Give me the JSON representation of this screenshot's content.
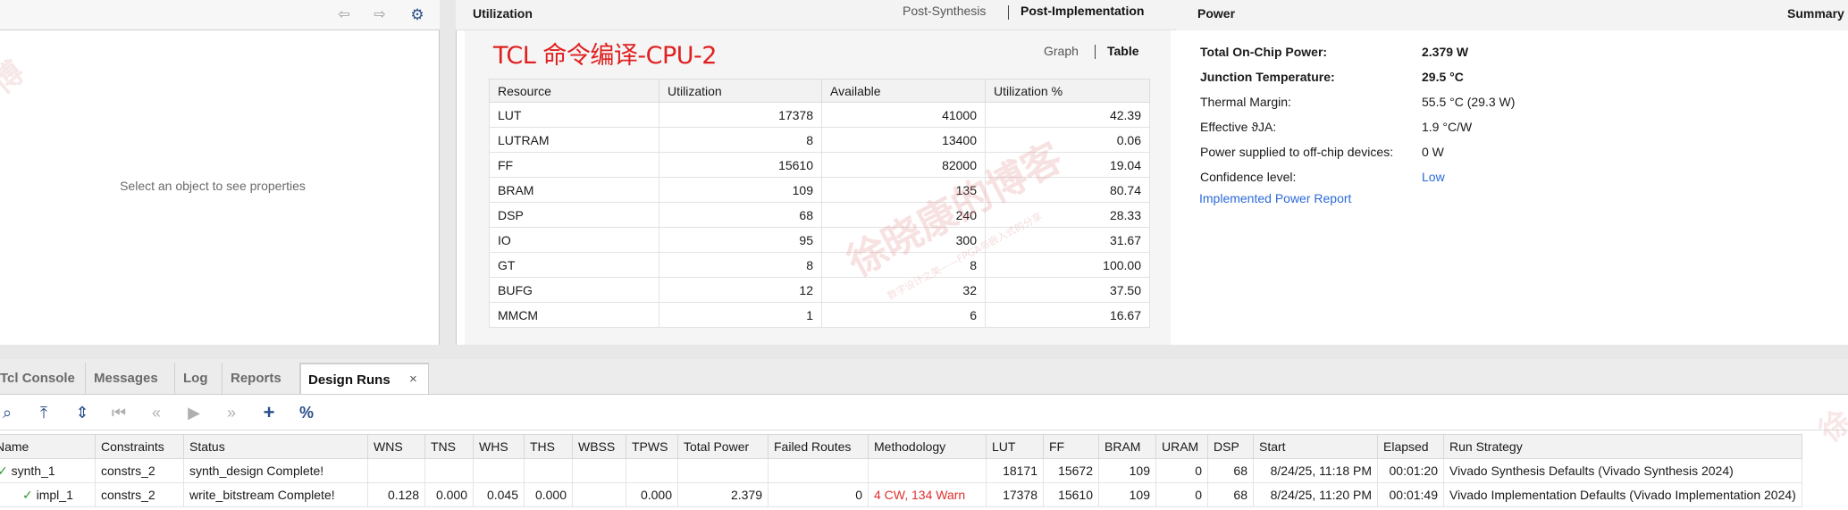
{
  "properties": {
    "empty_text": "Select an object to see properties",
    "icons": [
      "back-arrow-icon",
      "forward-arrow-icon",
      "gear-icon"
    ]
  },
  "utilization": {
    "title": "Utilization",
    "tabs": [
      "Post-Synthesis",
      "Post-Implementation"
    ],
    "active_tab": "Post-Implementation",
    "subtitle": "TCL 命令编译-CPU-2",
    "view_tabs": [
      "Graph",
      "Table"
    ],
    "active_view": "Table",
    "columns": [
      "Resource",
      "Utilization",
      "Available",
      "Utilization %"
    ],
    "rows": [
      {
        "resource": "LUT",
        "utilization": "17378",
        "available": "41000",
        "percent": "42.39"
      },
      {
        "resource": "LUTRAM",
        "utilization": "8",
        "available": "13400",
        "percent": "0.06"
      },
      {
        "resource": "FF",
        "utilization": "15610",
        "available": "82000",
        "percent": "19.04"
      },
      {
        "resource": "BRAM",
        "utilization": "109",
        "available": "135",
        "percent": "80.74"
      },
      {
        "resource": "DSP",
        "utilization": "68",
        "available": "240",
        "percent": "28.33"
      },
      {
        "resource": "IO",
        "utilization": "95",
        "available": "300",
        "percent": "31.67"
      },
      {
        "resource": "GT",
        "utilization": "8",
        "available": "8",
        "percent": "100.00"
      },
      {
        "resource": "BUFG",
        "utilization": "12",
        "available": "32",
        "percent": "37.50"
      },
      {
        "resource": "MMCM",
        "utilization": "1",
        "available": "6",
        "percent": "16.67"
      }
    ]
  },
  "power": {
    "title": "Power",
    "summary_label": "Summary",
    "rows": [
      {
        "key": "Total On-Chip Power:",
        "value": "2.379 W"
      },
      {
        "key": "Junction Temperature:",
        "value": "29.5 °C"
      },
      {
        "key": "Thermal Margin:",
        "value": "55.5 °C (29.3 W)"
      },
      {
        "key": "Effective ϑJA:",
        "value": "1.9 °C/W"
      },
      {
        "key": "Power supplied to off-chip devices:",
        "value": "0 W"
      },
      {
        "key": "Confidence level:",
        "value": "Low"
      }
    ],
    "report_link": "Implemented Power Report"
  },
  "bottom": {
    "tabs": [
      "Tcl Console",
      "Messages",
      "Log",
      "Reports",
      "Design Runs"
    ],
    "active_tab": "Design Runs",
    "close_glyph": "×",
    "toolbar_icons": [
      "search-icon",
      "collapse-all-icon",
      "expand-all-icon",
      "first-icon",
      "previous-icon",
      "run-icon",
      "next-icon",
      "add-icon",
      "percent-icon"
    ],
    "runs": {
      "columns": [
        "Name",
        "Constraints",
        "Status",
        "WNS",
        "TNS",
        "WHS",
        "THS",
        "WBSS",
        "TPWS",
        "Total Power",
        "Failed Routes",
        "Methodology",
        "LUT",
        "FF",
        "BRAM",
        "URAM",
        "DSP",
        "Start",
        "Elapsed",
        "Run Strategy"
      ],
      "rows": [
        {
          "name": "synth_1",
          "constraints": "constrs_2",
          "status": "synth_design Complete!",
          "wns": "",
          "tns": "",
          "whs": "",
          "ths": "",
          "wbss": "",
          "tpws": "",
          "total_power": "",
          "failed_routes": "",
          "methodology": "",
          "lut": "18171",
          "ff": "15672",
          "bram": "109",
          "uram": "0",
          "dsp": "68",
          "start": "8/24/25, 11:18 PM",
          "elapsed": "00:01:20",
          "strategy": "Vivado Synthesis Defaults (Vivado Synthesis 2024)"
        },
        {
          "name": "impl_1",
          "constraints": "constrs_2",
          "status": "write_bitstream Complete!",
          "wns": "0.128",
          "tns": "0.000",
          "whs": "0.045",
          "ths": "0.000",
          "wbss": "",
          "tpws": "0.000",
          "total_power": "2.379",
          "failed_routes": "0",
          "methodology": "4 CW, 134 Warn",
          "lut": "17378",
          "ff": "15610",
          "bram": "109",
          "uram": "0",
          "dsp": "68",
          "start": "8/24/25, 11:20 PM",
          "elapsed": "00:01:49",
          "strategy": "Vivado Implementation Defaults (Vivado Implementation 2024)"
        }
      ]
    }
  },
  "watermark": {
    "text": "徐晓康的博客",
    "sub": "数字设计之美——FPGA与嵌入式的分享"
  },
  "colors": {
    "accent_red": "#e02020",
    "link_blue": "#2a6ad8",
    "check_green": "#2a9a2a"
  }
}
